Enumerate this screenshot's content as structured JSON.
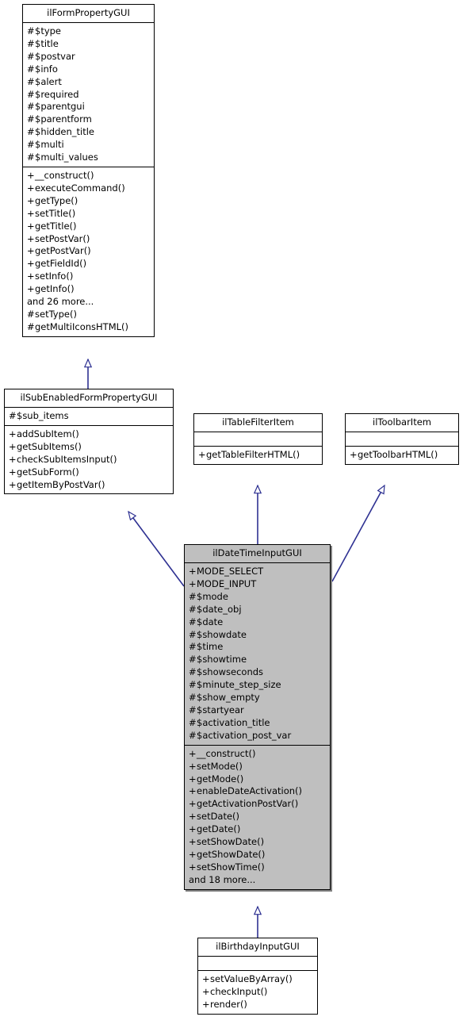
{
  "diagram": {
    "type": "uml-class-inheritance-diagram",
    "colors": {
      "background": "#ffffff",
      "box_fill": "#ffffff",
      "highlight_fill": "#bfbfbf",
      "border": "#000000",
      "edge": "#2e3192",
      "shadow": "#808080"
    }
  },
  "classes": {
    "form_property": {
      "name": "ilFormPropertyGUI",
      "attributes": [
        "# $type",
        "# $title",
        "# $postvar",
        "# $info",
        "# $alert",
        "# $required",
        "# $parentgui",
        "# $parentform",
        "# $hidden_title",
        "# $multi",
        "# $multi_values"
      ],
      "methods": [
        "+ __construct()",
        "+ executeCommand()",
        "+ getType()",
        "+ setTitle()",
        "+ getTitle()",
        "+ setPostVar()",
        "+ getPostVar()",
        "+ getFieldId()",
        "+ setInfo()",
        "+ getInfo()",
        "and 26 more...",
        "# setType()",
        "# getMultiIconsHTML()"
      ]
    },
    "sub_enabled": {
      "name": "ilSubEnabledFormPropertyGUI",
      "attributes": [
        "# $sub_items"
      ],
      "methods": [
        "+ addSubItem()",
        "+ getSubItems()",
        "+ checkSubItemsInput()",
        "+ getSubForm()",
        "+ getItemByPostVar()"
      ]
    },
    "table_filter": {
      "name": "ilTableFilterItem",
      "attributes": [],
      "methods": [
        "+ getTableFilterHTML()"
      ]
    },
    "toolbar_item": {
      "name": "ilToolbarItem",
      "attributes": [],
      "methods": [
        "+ getToolbarHTML()"
      ]
    },
    "date_time_input": {
      "name": "ilDateTimeInputGUI",
      "attributes": [
        "+ MODE_SELECT",
        "+ MODE_INPUT",
        "# $mode",
        "# $date_obj",
        "# $date",
        "# $showdate",
        "# $time",
        "# $showtime",
        "# $showseconds",
        "# $minute_step_size",
        "# $show_empty",
        "# $startyear",
        "# $activation_title",
        "# $activation_post_var"
      ],
      "methods": [
        "+ __construct()",
        "+ setMode()",
        "+ getMode()",
        "+ enableDateActivation()",
        "+ getActivationPostVar()",
        "+ setDate()",
        "+ getDate()",
        "+ setShowDate()",
        "+ getShowDate()",
        "+ setShowTime()",
        "and 18 more..."
      ]
    },
    "birthday_input": {
      "name": "ilBirthdayInputGUI",
      "attributes": [],
      "methods": [
        "+ setValueByArray()",
        "+ checkInput()",
        "+ render()"
      ]
    }
  },
  "relations": [
    {
      "from": "ilSubEnabledFormPropertyGUI",
      "to": "ilFormPropertyGUI",
      "kind": "generalization"
    },
    {
      "from": "ilDateTimeInputGUI",
      "to": "ilSubEnabledFormPropertyGUI",
      "kind": "generalization"
    },
    {
      "from": "ilDateTimeInputGUI",
      "to": "ilTableFilterItem",
      "kind": "generalization"
    },
    {
      "from": "ilDateTimeInputGUI",
      "to": "ilToolbarItem",
      "kind": "generalization"
    },
    {
      "from": "ilBirthdayInputGUI",
      "to": "ilDateTimeInputGUI",
      "kind": "generalization"
    }
  ]
}
